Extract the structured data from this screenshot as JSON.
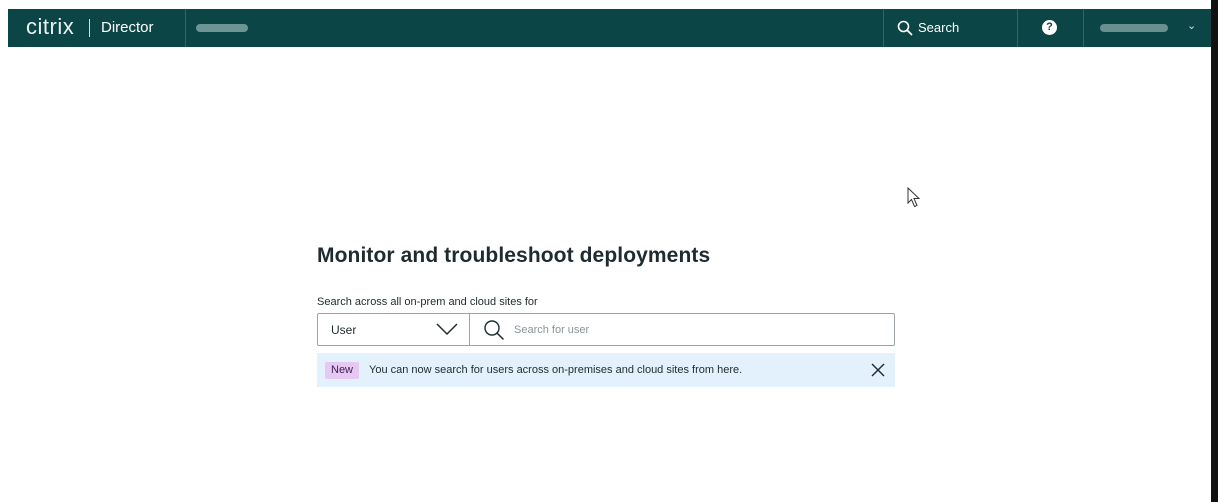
{
  "header": {
    "brand": "citrix",
    "product": "Director",
    "search_label": "Search",
    "help_glyph": "?",
    "user_caret": "⌄"
  },
  "main": {
    "title": "Monitor and troubleshoot deployments",
    "search_caption": "Search across all on-prem and cloud sites for",
    "search_type": "User",
    "search_placeholder": "Search for user",
    "banner": {
      "badge": "New",
      "text_before_link": "You can now search for users across on-premises and cloud sites from ",
      "link": "here",
      "text_after_link": "."
    }
  },
  "colors": {
    "header_bg": "#0b4545",
    "banner_bg": "#e2f1fb",
    "badge_bg": "#e6c9f2"
  },
  "icons": {
    "header_search": "search-icon",
    "help": "help-icon",
    "dropdown": "chevron-down-icon",
    "search": "search-icon",
    "close": "close-icon"
  }
}
